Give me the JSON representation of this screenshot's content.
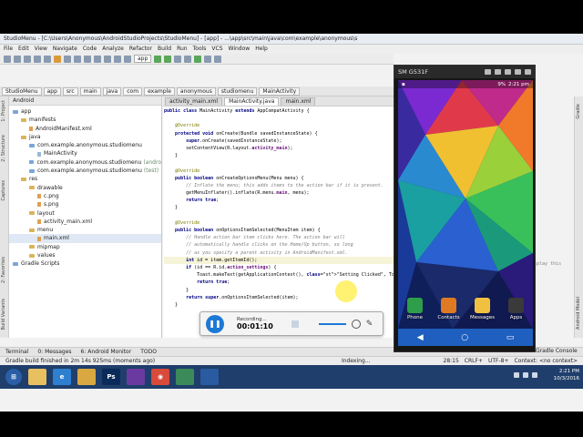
{
  "window": {
    "title": "StudioMenu - [C:\\Users\\Anonymous\\AndroidStudioProjects\\StudioMenu] - [app] - ...\\app\\src\\main\\java\\com\\example\\anonymous\\s"
  },
  "menubar": [
    "File",
    "Edit",
    "View",
    "Navigate",
    "Code",
    "Analyze",
    "Refactor",
    "Build",
    "Run",
    "Tools",
    "VCS",
    "Window",
    "Help"
  ],
  "toolbar": {
    "app_selector": "app"
  },
  "breadcrumbs": [
    "StudioMenu",
    "app",
    "src",
    "main",
    "java",
    "com",
    "example",
    "anonymous",
    "studiomenu",
    "MainActivity"
  ],
  "project": {
    "header": "Android",
    "tree": [
      {
        "label": "app",
        "depth": 0,
        "kind": "folder-b"
      },
      {
        "label": "manifests",
        "depth": 1,
        "kind": "folder"
      },
      {
        "label": "AndroidManifest.xml",
        "depth": 2,
        "kind": "file-o"
      },
      {
        "label": "java",
        "depth": 1,
        "kind": "folder"
      },
      {
        "label": "com.example.anonymous.studiomenu",
        "depth": 2,
        "kind": "folder-b"
      },
      {
        "label": "MainActivity",
        "depth": 3,
        "kind": "file"
      },
      {
        "label": "com.example.anonymous.studiomenu",
        "suffix": "(andro",
        "depth": 2,
        "kind": "folder-b"
      },
      {
        "label": "com.example.anonymous.studiomenu",
        "suffix": "(test)",
        "depth": 2,
        "kind": "folder-b"
      },
      {
        "label": "res",
        "depth": 1,
        "kind": "folder"
      },
      {
        "label": "drawable",
        "depth": 2,
        "kind": "folder"
      },
      {
        "label": "c.png",
        "depth": 3,
        "kind": "file-o"
      },
      {
        "label": "s.png",
        "depth": 3,
        "kind": "file-o"
      },
      {
        "label": "layout",
        "depth": 2,
        "kind": "folder"
      },
      {
        "label": "activity_main.xml",
        "depth": 3,
        "kind": "file-o"
      },
      {
        "label": "menu",
        "depth": 2,
        "kind": "folder"
      },
      {
        "label": "main.xml",
        "depth": 3,
        "kind": "file-o",
        "selected": true
      },
      {
        "label": "mipmap",
        "depth": 2,
        "kind": "folder"
      },
      {
        "label": "values",
        "depth": 2,
        "kind": "folder"
      },
      {
        "label": "Gradle Scripts",
        "depth": 0,
        "kind": "folder-b"
      }
    ]
  },
  "editor": {
    "tabs": [
      "activity_main.xml",
      "MainActivity.java",
      "main.xml"
    ],
    "active_tab": 1,
    "code": [
      "public class MainActivity extends AppCompatActivity {",
      "",
      "    @Override",
      "    protected void onCreate(Bundle savedInstanceState) {",
      "        super.onCreate(savedInstanceState);",
      "        setContentView(R.layout.activity_main);",
      "    }",
      "",
      "    @Override",
      "    public boolean onCreateOptionsMenu(Menu menu) {",
      "        // Inflate the menu; this adds items to the action bar if it is present.",
      "        getMenuInflater().inflate(R.menu.main, menu);",
      "        return true;",
      "    }",
      "",
      "    @Override",
      "    public boolean onOptionsItemSelected(MenuItem item) {",
      "        // Handle action bar item clicks here. The action bar will",
      "        // automatically handle clicks on the Home/Up button, so long",
      "        // as you specify a parent activity in AndroidManifest.xml.",
      "        int id = item.getItemId();",
      "        if (id == R.id.action_settings) {",
      "            Toast.makeText(getApplicationContext(), \"Setting Clicked\", Toa",
      "            return true;",
      "        }",
      "        return super.onOptionsItemSelected(item);",
      "    }",
      "}"
    ],
    "highlight_line": 20
  },
  "right_overflow_text": "display this",
  "bottom_tabs": [
    "Terminal",
    "0: Messages",
    "6: Android Monitor",
    "TODO"
  ],
  "status": {
    "left": "Gradle build finished in 2m 14s 925ms (moments ago)",
    "indexing": "Indexing...",
    "position": "28:15",
    "line_sep": "CRLF+",
    "encoding": "UTF-8+",
    "context": "Context: <no context>",
    "gradle_console": "Gradle Console",
    "android_model": "Android Model"
  },
  "emulator": {
    "device": "SM G531F",
    "time": "2:21 pm",
    "battery": "9%",
    "apps": [
      {
        "label": "Phone",
        "color": "#2e9e4a"
      },
      {
        "label": "Contacts",
        "color": "#e07a22"
      },
      {
        "label": "Messages",
        "color": "#f0c040"
      },
      {
        "label": "Apps",
        "color": "#3a3a3a"
      }
    ],
    "nav": [
      "◀",
      "○",
      "▭"
    ]
  },
  "recorder": {
    "status_label": "Recording...",
    "elapsed": "00:01:10"
  },
  "taskbar": {
    "clock_time": "2:21 PM",
    "clock_date": "10/3/2016",
    "apps": [
      {
        "name": "explorer",
        "color": "#e8c060",
        "glyph": ""
      },
      {
        "name": "ie",
        "color": "#2e7fd0",
        "glyph": "e"
      },
      {
        "name": "folder",
        "color": "#d9a840",
        "glyph": ""
      },
      {
        "name": "photoshop",
        "color": "#0a2a5a",
        "glyph": "Ps"
      },
      {
        "name": "app-purple",
        "color": "#6a3aa0",
        "glyph": ""
      },
      {
        "name": "chrome",
        "color": "#d84a3a",
        "glyph": "◉"
      },
      {
        "name": "android-studio",
        "color": "#3a8a5a",
        "glyph": ""
      },
      {
        "name": "recorder-app",
        "color": "#2a5aa0",
        "glyph": ""
      }
    ]
  },
  "side_labels": {
    "left": [
      "1: Project",
      "2: Structure",
      "Captures",
      "Build Variants",
      "2: Favorites"
    ],
    "right": [
      "Gradle",
      "Android Model"
    ]
  }
}
